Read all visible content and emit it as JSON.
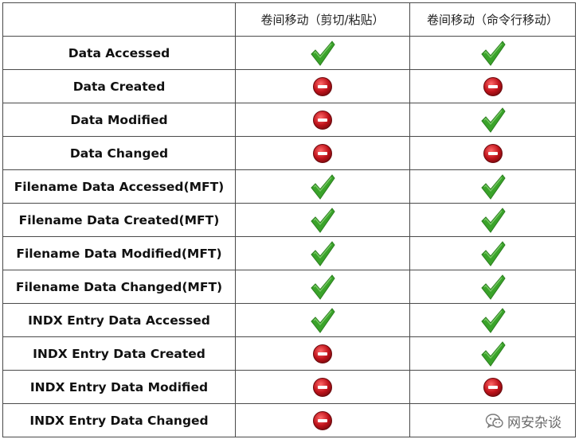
{
  "table": {
    "header": [
      "",
      "卷间移动（剪切/粘贴）",
      "卷间移动（命令行移动）"
    ],
    "rows": [
      {
        "label": "Data Accessed",
        "cut_paste": "check",
        "cmd_move": "check"
      },
      {
        "label": "Data Created",
        "cut_paste": "no",
        "cmd_move": "no"
      },
      {
        "label": "Data Modified",
        "cut_paste": "no",
        "cmd_move": "check"
      },
      {
        "label": "Data Changed",
        "cut_paste": "no",
        "cmd_move": "no"
      },
      {
        "label": "Filename Data Accessed(MFT)",
        "cut_paste": "check",
        "cmd_move": "check"
      },
      {
        "label": "Filename Data Created(MFT)",
        "cut_paste": "check",
        "cmd_move": "check"
      },
      {
        "label": "Filename Data Modified(MFT)",
        "cut_paste": "check",
        "cmd_move": "check"
      },
      {
        "label": "Filename Data Changed(MFT)",
        "cut_paste": "check",
        "cmd_move": "check"
      },
      {
        "label": "INDX Entry Data Accessed",
        "cut_paste": "check",
        "cmd_move": "check"
      },
      {
        "label": "INDX Entry Data Created",
        "cut_paste": "no",
        "cmd_move": "check"
      },
      {
        "label": "INDX Entry Data Modified",
        "cut_paste": "no",
        "cmd_move": "no"
      },
      {
        "label": "INDX Entry Data Changed",
        "cut_paste": "no",
        "cmd_move": ""
      }
    ]
  },
  "icons": {
    "check": "green-check-icon",
    "no": "red-no-entry-icon"
  },
  "colors": {
    "check_green": "#3aa32a",
    "no_red": "#c0131b"
  },
  "watermark": {
    "text": "网安杂谈",
    "icon": "wechat-icon"
  }
}
